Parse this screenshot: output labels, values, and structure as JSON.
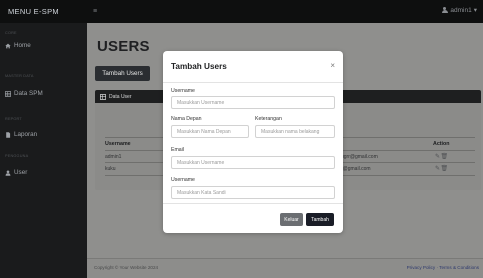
{
  "topbar": {
    "brand": "MENU E-SPM",
    "toggle_icon": "≡",
    "user_label": "admin1",
    "caret": "▾"
  },
  "sidebar": {
    "items": [
      {
        "section": "CORE",
        "label": "Home",
        "icon": "home-icon"
      },
      {
        "section": "MASTER DATA",
        "label": "Data SPM",
        "icon": "table-icon"
      },
      {
        "section": "REPORT",
        "label": "Laporan",
        "icon": "file-icon"
      },
      {
        "section": "PENGGUNA",
        "label": "User",
        "icon": "user-icon"
      }
    ]
  },
  "main": {
    "page_title": "USERS",
    "add_button": "Tambah Users",
    "card_header": "Data User",
    "table": {
      "headers": [
        "Username",
        "Action"
      ],
      "rows": [
        {
          "username": "admin1",
          "email": "ugrr@gmail.com"
        },
        {
          "username": "kuku",
          "email": "r@gmail.com"
        }
      ]
    },
    "footer": {
      "copyright": "Copyright © Your Website 2024",
      "links": "Privacy Policy · Terms & Conditions"
    }
  },
  "modal": {
    "title": "Tambah Users",
    "close": "×",
    "fields": {
      "username": {
        "label": "Username",
        "placeholder": "Masukkan Username"
      },
      "nama_depan": {
        "label": "Nama Depan",
        "placeholder": "Masukkan Nama Depan"
      },
      "keterangan": {
        "label": "Keterangan",
        "placeholder": "Masukkan nama belakang"
      },
      "email": {
        "label": "Email",
        "placeholder": "Masukkan Username"
      },
      "password": {
        "label": "Username",
        "placeholder": "Masukkan Kata Sandi"
      }
    },
    "buttons": {
      "keluar": "Keluar",
      "tambah": "Tambah"
    }
  },
  "colors": {
    "topbar": "#0e0f0f",
    "sidebar": "#1a1b1c",
    "overlay_content": "#8f8f8d",
    "primary_dark": "#1a1d27"
  }
}
